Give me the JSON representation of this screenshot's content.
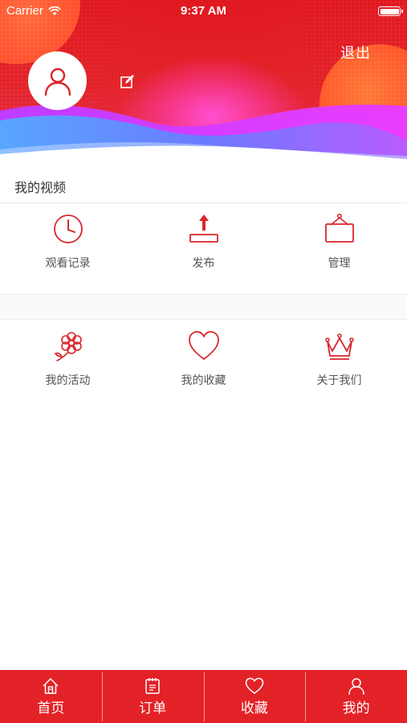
{
  "status_bar": {
    "carrier": "Carrier",
    "time": "9:37 AM"
  },
  "header": {
    "logout_label": "退出"
  },
  "my_videos": {
    "title": "我的视频",
    "items": [
      {
        "label": "观看记录",
        "icon": "clock-icon"
      },
      {
        "label": "发布",
        "icon": "upload-icon"
      },
      {
        "label": "管理",
        "icon": "hanging-sign-icon"
      }
    ]
  },
  "more": {
    "items": [
      {
        "label": "我的活动",
        "icon": "flower-icon"
      },
      {
        "label": "我的收藏",
        "icon": "heart-icon"
      },
      {
        "label": "关于我们",
        "icon": "crown-icon"
      }
    ]
  },
  "tabbar": {
    "items": [
      {
        "label": "首页",
        "icon": "home-icon"
      },
      {
        "label": "订单",
        "icon": "notepad-icon"
      },
      {
        "label": "收藏",
        "icon": "heart-icon"
      },
      {
        "label": "我的",
        "icon": "person-icon"
      }
    ]
  },
  "colors": {
    "accent": "#e32227",
    "icon_red": "#d9252b"
  }
}
